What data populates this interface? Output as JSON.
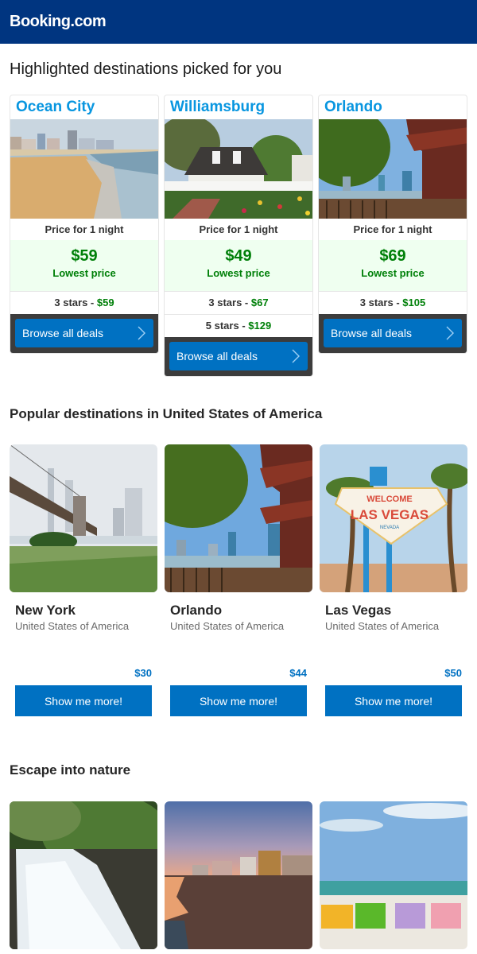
{
  "header": {
    "logo": "Booking.com"
  },
  "highlighted": {
    "title": "Highlighted destinations picked for you",
    "cards": [
      {
        "name": "Ocean City",
        "image": "beach-boardwalk-photo",
        "price_label": "Price for 1 night",
        "lowest_amount": "$59",
        "lowest_label": "Lowest price",
        "tiers": [
          {
            "label": "3 stars -",
            "price": "$59"
          }
        ],
        "cta": "Browse all deals"
      },
      {
        "name": "Williamsburg",
        "image": "colonial-house-garden-photo",
        "price_label": "Price for 1 night",
        "lowest_amount": "$49",
        "lowest_label": "Lowest price",
        "tiers": [
          {
            "label": "3 stars -",
            "price": "$67"
          },
          {
            "label": "5 stars -",
            "price": "$129"
          }
        ],
        "cta": "Browse all deals"
      },
      {
        "name": "Orlando",
        "image": "lake-pagoda-skyline-photo",
        "price_label": "Price for 1 night",
        "lowest_amount": "$69",
        "lowest_label": "Lowest price",
        "tiers": [
          {
            "label": "3 stars -",
            "price": "$105"
          }
        ],
        "cta": "Browse all deals"
      }
    ]
  },
  "popular": {
    "title": "Popular destinations in United States of America",
    "cards": [
      {
        "name": "New York",
        "country": "United States of America",
        "price": "$30",
        "cta": "Show me more!",
        "image": "brooklyn-bridge-photo"
      },
      {
        "name": "Orlando",
        "country": "United States of America",
        "price": "$44",
        "cta": "Show me more!",
        "image": "lake-pagoda-skyline-photo"
      },
      {
        "name": "Las Vegas",
        "country": "United States of America",
        "price": "$50",
        "cta": "Show me more!",
        "image": "welcome-las-vegas-sign-photo"
      }
    ]
  },
  "nature": {
    "title": "Escape into nature",
    "images": [
      "waterfall-forest-photo",
      "sunset-beach-hotels-photo",
      "beach-adirondack-chairs-photo"
    ]
  },
  "colors": {
    "brand": "#003580",
    "accent": "#0071c2",
    "title_blue": "#0896e0",
    "price_green": "#008009"
  }
}
